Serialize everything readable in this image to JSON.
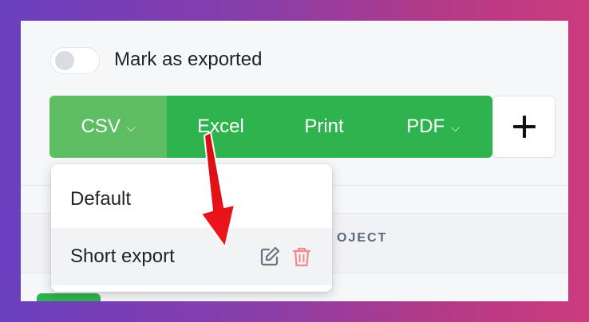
{
  "toggle": {
    "label": "Mark as exported",
    "checked": false
  },
  "export_buttons": [
    {
      "label": "CSV",
      "has_dropdown": true,
      "active": true
    },
    {
      "label": "Excel",
      "has_dropdown": false,
      "active": false
    },
    {
      "label": "Print",
      "has_dropdown": false,
      "active": false
    },
    {
      "label": "PDF",
      "has_dropdown": true,
      "active": false
    }
  ],
  "add_button": {
    "icon": "plus-icon"
  },
  "table": {
    "column_header_partial": "OJECT"
  },
  "dropdown": {
    "items": [
      {
        "label": "Default"
      },
      {
        "label": "Short export",
        "actions": [
          "edit-icon",
          "trash-icon"
        ]
      }
    ]
  },
  "colors": {
    "brand_green": "#2fb34f",
    "active_green": "#5fbd63",
    "annotation_red": "#e8141a",
    "delete_red": "#f08a8a"
  }
}
